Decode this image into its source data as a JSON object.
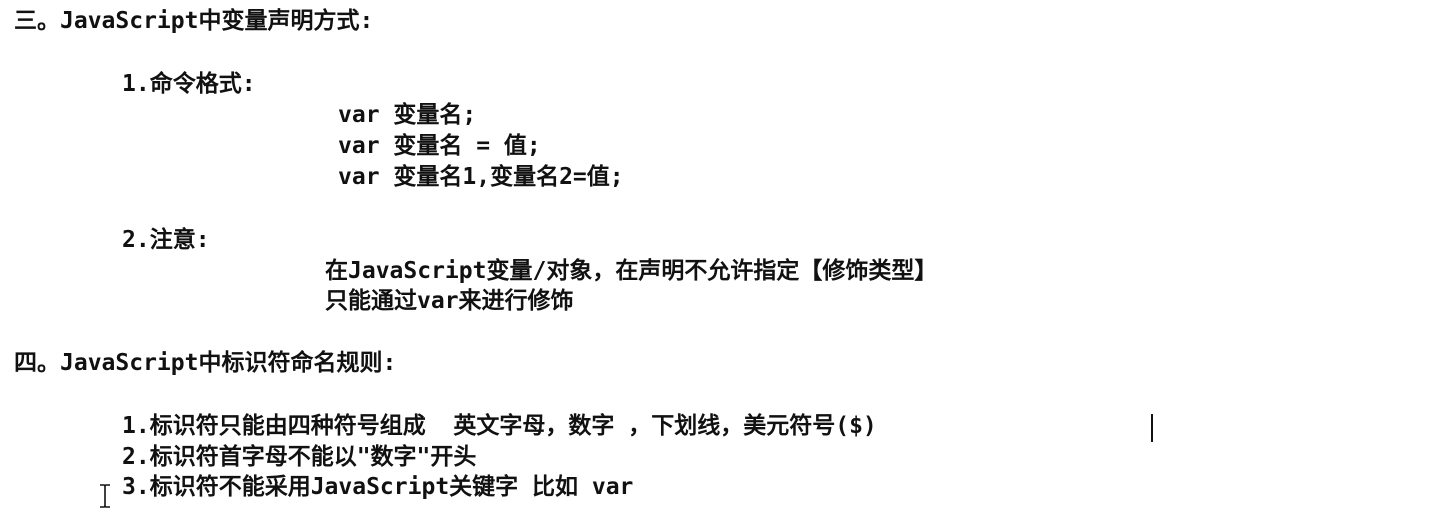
{
  "section3": {
    "heading": "三。JavaScript中变量声明方式:",
    "item1": {
      "title": "1.命令格式:",
      "lines": [
        "var 变量名;",
        "var 变量名 = 值;",
        "var 变量名1,变量名2=值;"
      ]
    },
    "item2": {
      "title": "2.注意:",
      "lines": [
        "在JavaScript变量/对象，在声明不允许指定【修饰类型】",
        "只能通过var来进行修饰"
      ]
    }
  },
  "section4": {
    "heading": "四。JavaScript中标识符命名规则:",
    "rules": [
      "1.标识符只能由四种符号组成  英文字母，数字 ，下划线，美元符号($)",
      "2.标识符首字母不能以\"数字\"开头",
      "3.标识符不能采用JavaScript关键字 比如 var"
    ]
  },
  "icons": {
    "text_cursor": "i-beam-cursor-icon",
    "caret": "text-caret"
  }
}
